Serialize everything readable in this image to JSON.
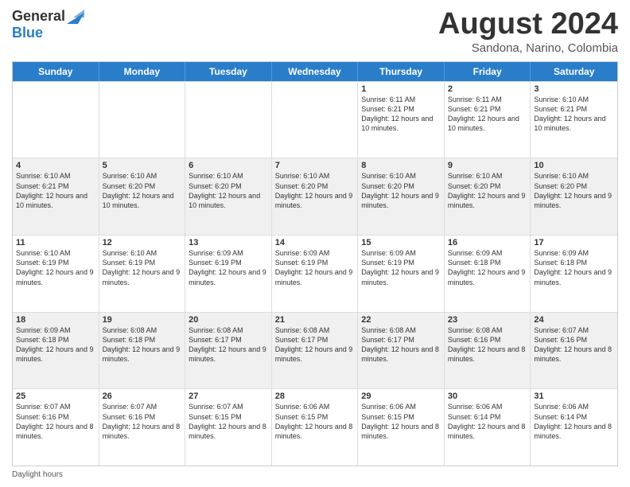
{
  "logo": {
    "general": "General",
    "blue": "Blue"
  },
  "title": "August 2024",
  "location": "Sandona, Narino, Colombia",
  "days_of_week": [
    "Sunday",
    "Monday",
    "Tuesday",
    "Wednesday",
    "Thursday",
    "Friday",
    "Saturday"
  ],
  "footer_label": "Daylight hours",
  "weeks": [
    [
      {
        "day": "",
        "info": ""
      },
      {
        "day": "",
        "info": ""
      },
      {
        "day": "",
        "info": ""
      },
      {
        "day": "",
        "info": ""
      },
      {
        "day": "1",
        "info": "Sunrise: 6:11 AM\nSunset: 6:21 PM\nDaylight: 12 hours and 10 minutes."
      },
      {
        "day": "2",
        "info": "Sunrise: 6:11 AM\nSunset: 6:21 PM\nDaylight: 12 hours and 10 minutes."
      },
      {
        "day": "3",
        "info": "Sunrise: 6:10 AM\nSunset: 6:21 PM\nDaylight: 12 hours and 10 minutes."
      }
    ],
    [
      {
        "day": "4",
        "info": "Sunrise: 6:10 AM\nSunset: 6:21 PM\nDaylight: 12 hours and 10 minutes."
      },
      {
        "day": "5",
        "info": "Sunrise: 6:10 AM\nSunset: 6:20 PM\nDaylight: 12 hours and 10 minutes."
      },
      {
        "day": "6",
        "info": "Sunrise: 6:10 AM\nSunset: 6:20 PM\nDaylight: 12 hours and 10 minutes."
      },
      {
        "day": "7",
        "info": "Sunrise: 6:10 AM\nSunset: 6:20 PM\nDaylight: 12 hours and 9 minutes."
      },
      {
        "day": "8",
        "info": "Sunrise: 6:10 AM\nSunset: 6:20 PM\nDaylight: 12 hours and 9 minutes."
      },
      {
        "day": "9",
        "info": "Sunrise: 6:10 AM\nSunset: 6:20 PM\nDaylight: 12 hours and 9 minutes."
      },
      {
        "day": "10",
        "info": "Sunrise: 6:10 AM\nSunset: 6:20 PM\nDaylight: 12 hours and 9 minutes."
      }
    ],
    [
      {
        "day": "11",
        "info": "Sunrise: 6:10 AM\nSunset: 6:19 PM\nDaylight: 12 hours and 9 minutes."
      },
      {
        "day": "12",
        "info": "Sunrise: 6:10 AM\nSunset: 6:19 PM\nDaylight: 12 hours and 9 minutes."
      },
      {
        "day": "13",
        "info": "Sunrise: 6:09 AM\nSunset: 6:19 PM\nDaylight: 12 hours and 9 minutes."
      },
      {
        "day": "14",
        "info": "Sunrise: 6:09 AM\nSunset: 6:19 PM\nDaylight: 12 hours and 9 minutes."
      },
      {
        "day": "15",
        "info": "Sunrise: 6:09 AM\nSunset: 6:19 PM\nDaylight: 12 hours and 9 minutes."
      },
      {
        "day": "16",
        "info": "Sunrise: 6:09 AM\nSunset: 6:18 PM\nDaylight: 12 hours and 9 minutes."
      },
      {
        "day": "17",
        "info": "Sunrise: 6:09 AM\nSunset: 6:18 PM\nDaylight: 12 hours and 9 minutes."
      }
    ],
    [
      {
        "day": "18",
        "info": "Sunrise: 6:09 AM\nSunset: 6:18 PM\nDaylight: 12 hours and 9 minutes."
      },
      {
        "day": "19",
        "info": "Sunrise: 6:08 AM\nSunset: 6:18 PM\nDaylight: 12 hours and 9 minutes."
      },
      {
        "day": "20",
        "info": "Sunrise: 6:08 AM\nSunset: 6:17 PM\nDaylight: 12 hours and 9 minutes."
      },
      {
        "day": "21",
        "info": "Sunrise: 6:08 AM\nSunset: 6:17 PM\nDaylight: 12 hours and 9 minutes."
      },
      {
        "day": "22",
        "info": "Sunrise: 6:08 AM\nSunset: 6:17 PM\nDaylight: 12 hours and 8 minutes."
      },
      {
        "day": "23",
        "info": "Sunrise: 6:08 AM\nSunset: 6:16 PM\nDaylight: 12 hours and 8 minutes."
      },
      {
        "day": "24",
        "info": "Sunrise: 6:07 AM\nSunset: 6:16 PM\nDaylight: 12 hours and 8 minutes."
      }
    ],
    [
      {
        "day": "25",
        "info": "Sunrise: 6:07 AM\nSunset: 6:16 PM\nDaylight: 12 hours and 8 minutes."
      },
      {
        "day": "26",
        "info": "Sunrise: 6:07 AM\nSunset: 6:16 PM\nDaylight: 12 hours and 8 minutes."
      },
      {
        "day": "27",
        "info": "Sunrise: 6:07 AM\nSunset: 6:15 PM\nDaylight: 12 hours and 8 minutes."
      },
      {
        "day": "28",
        "info": "Sunrise: 6:06 AM\nSunset: 6:15 PM\nDaylight: 12 hours and 8 minutes."
      },
      {
        "day": "29",
        "info": "Sunrise: 6:06 AM\nSunset: 6:15 PM\nDaylight: 12 hours and 8 minutes."
      },
      {
        "day": "30",
        "info": "Sunrise: 6:06 AM\nSunset: 6:14 PM\nDaylight: 12 hours and 8 minutes."
      },
      {
        "day": "31",
        "info": "Sunrise: 6:06 AM\nSunset: 6:14 PM\nDaylight: 12 hours and 8 minutes."
      }
    ]
  ]
}
